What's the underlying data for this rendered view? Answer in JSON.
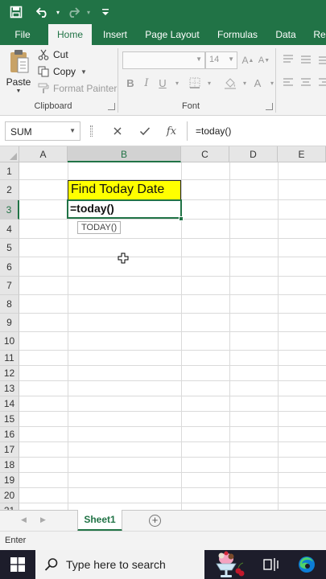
{
  "titlebar": {
    "accent_color": "#217346",
    "icons": [
      "save-icon",
      "undo-icon",
      "redo-icon",
      "customize-icon"
    ]
  },
  "ribbon_tabs": [
    "File",
    "Home",
    "Insert",
    "Page Layout",
    "Formulas",
    "Data",
    "Re"
  ],
  "active_tab": "Home",
  "clipboard": {
    "paste_label": "Paste",
    "cut_label": "Cut",
    "copy_label": "Copy",
    "format_painter_label": "Format Painter",
    "group_label": "Clipboard"
  },
  "font": {
    "family_value": "",
    "size_value": "14",
    "group_label": "Font"
  },
  "formula_bar": {
    "name_box": "SUM",
    "cancel_icon": "cancel-icon",
    "enter_icon": "check-icon",
    "fx_label": "fx",
    "formula": "=today()"
  },
  "columns": [
    "A",
    "B",
    "C",
    "D",
    "E"
  ],
  "rows": [
    "1",
    "2",
    "3",
    "4",
    "5",
    "6",
    "7",
    "8",
    "9",
    "10",
    "11",
    "12",
    "13",
    "14",
    "15",
    "16",
    "17",
    "18",
    "19",
    "20",
    "21"
  ],
  "cells": {
    "B2": "Find Today Date",
    "B3": "=today()",
    "B2_fill": "#ffff00"
  },
  "autocomplete_tip": "TODAY()",
  "sheet_tabs": [
    "Sheet1"
  ],
  "status": {
    "mode": "Enter"
  },
  "taskbar": {
    "search_placeholder": "Type here to search"
  }
}
